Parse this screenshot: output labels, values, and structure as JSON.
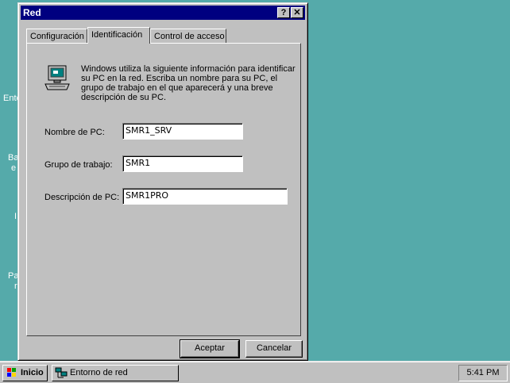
{
  "desktop": {
    "labels": [
      "Ento",
      "Ba",
      "e",
      "I",
      "Pa",
      "r"
    ]
  },
  "dialog": {
    "title": "Red",
    "help_label": "?",
    "close_label": "✕",
    "tabs": [
      {
        "label": "Configuración"
      },
      {
        "label": "Identificación"
      },
      {
        "label": "Control de acceso"
      }
    ],
    "info": "Windows utiliza la siguiente información para identificar su PC en la red. Escriba un nombre para su PC, el grupo de trabajo en el que aparecerá y una breve descripción de su PC.",
    "fields": {
      "pc_name": {
        "label": "Nombre de PC:",
        "value": "SMR1_SRV"
      },
      "workgroup": {
        "label": "Grupo de trabajo:",
        "value": "SMR1"
      },
      "description": {
        "label": "Descripción de PC:",
        "value": "SMR1PRO"
      }
    },
    "ok_label": "Aceptar",
    "cancel_label": "Cancelar"
  },
  "taskbar": {
    "start_label": "Inicio",
    "task_label": "Entorno de red",
    "clock": "5:41 PM"
  }
}
